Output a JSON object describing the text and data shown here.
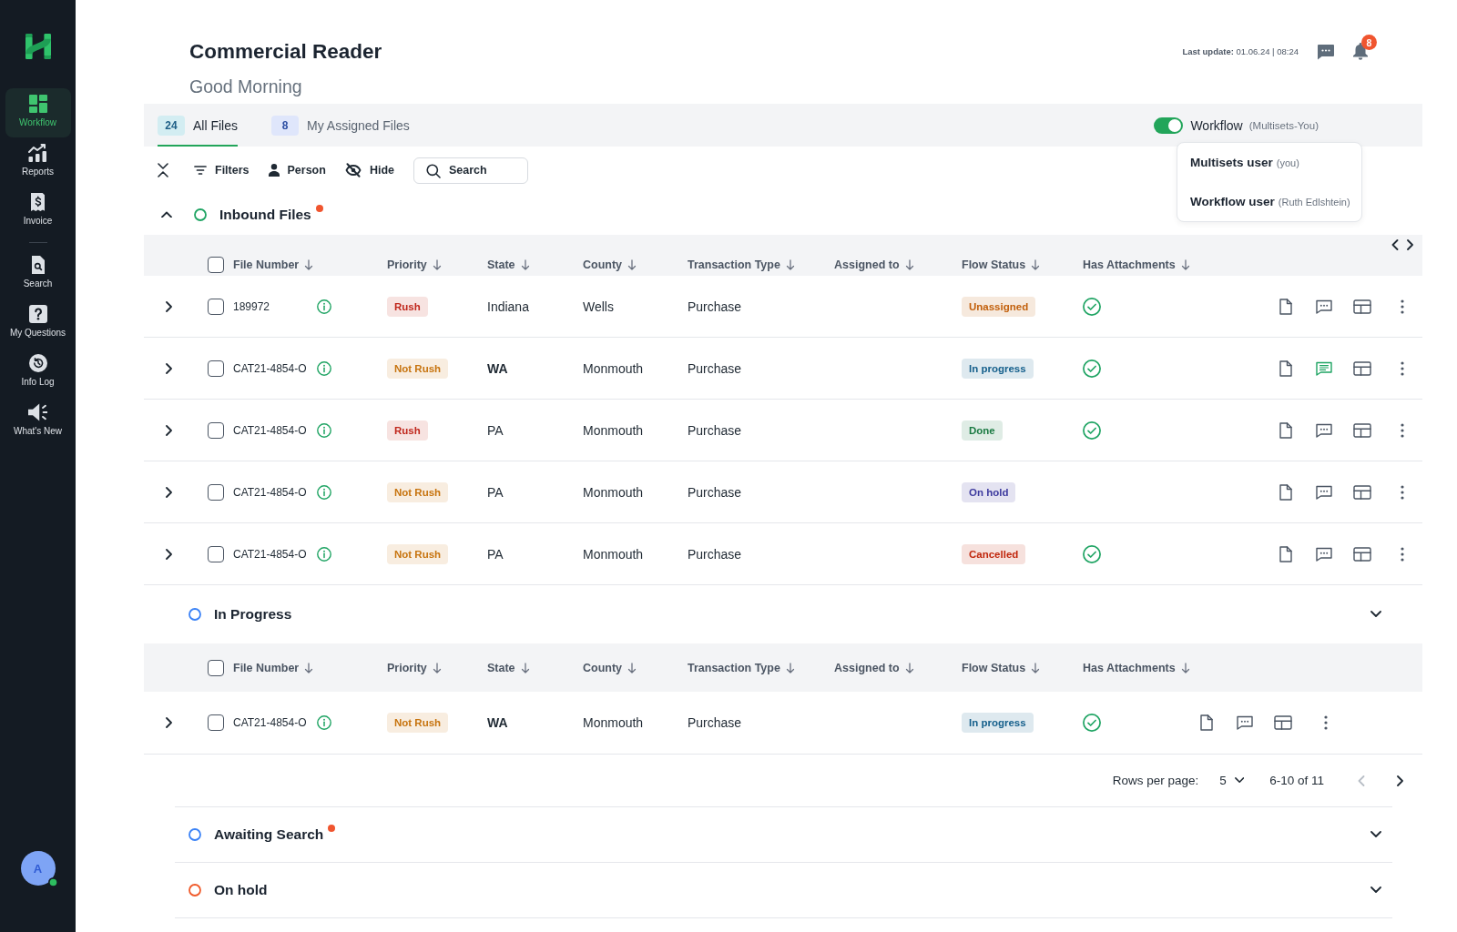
{
  "sidebar": {
    "items": [
      {
        "label": "Workflow",
        "selected": true
      },
      {
        "label": "Reports",
        "selected": false
      },
      {
        "label": "Invoice",
        "selected": false
      }
    ],
    "more_items": [
      {
        "label": "Search",
        "selected": false
      },
      {
        "label": "My Questions",
        "selected": false
      },
      {
        "label": "Info Log",
        "selected": false
      },
      {
        "label": "What's New",
        "selected": false
      }
    ],
    "avatar": {
      "initial": "A",
      "online": true
    }
  },
  "header": {
    "title": "Commercial Reader",
    "greeting": "Good Morning",
    "last_update": "**Last update:** 01.06.24 | 08:24",
    "notification_count": "8"
  },
  "tabs": [
    {
      "count": "24",
      "label": "All Files",
      "selected": true
    },
    {
      "count": "8",
      "label": "My Assigned Files",
      "selected": false
    }
  ],
  "workflow_toggle": {
    "on": true,
    "label": "Workflow",
    "detail": "(Multisets-You)"
  },
  "workflow_menu": {
    "items": [
      {
        "name": "Multisets user",
        "detail": "(you)"
      },
      {
        "name": "Workflow user",
        "detail": "(Ruth Edlshtein)"
      }
    ]
  },
  "toolbar": {
    "buttons": [
      "Filters",
      "Person",
      "Hide"
    ],
    "search": {
      "placeholder": "Search"
    }
  },
  "groups": [
    {
      "kind": "primary",
      "title": "Inbound Files",
      "color": "#1fa463",
      "unread": true,
      "expanded": true,
      "select_all_checked": false,
      "columns": [
        "File Number",
        "Priority",
        "State",
        "County",
        "Transaction Type",
        "Assigned to",
        "Flow Status",
        "Has Attachments"
      ],
      "rows": [
        {
          "expanded": false,
          "checked": false,
          "file_number": "189972",
          "priority": {
            "label": "Rush",
            "color": "#c0271c"
          },
          "state": "Indiana",
          "state_bold": false,
          "county": "Wells",
          "transaction_type": "Purchase",
          "flow_status": {
            "label": "Unassigned",
            "color": "#c2600c"
          },
          "has_attachments": true,
          "comments_active": false
        },
        {
          "expanded": false,
          "checked": false,
          "file_number": "CAT21-4854-O",
          "priority": {
            "label": "Not Rush",
            "color": "#c7740f"
          },
          "state": "WA",
          "state_bold": true,
          "county": "Monmouth",
          "transaction_type": "Purchase",
          "flow_status": {
            "label": "In progress",
            "color": "#16608c"
          },
          "has_attachments": true,
          "comments_active": true
        },
        {
          "expanded": false,
          "checked": false,
          "file_number": "CAT21-4854-O",
          "priority": {
            "label": "Rush",
            "color": "#c0271c"
          },
          "state": "PA",
          "state_bold": false,
          "county": "Monmouth",
          "transaction_type": "Purchase",
          "flow_status": {
            "label": "Done",
            "color": "#1b7a43"
          },
          "has_attachments": true,
          "comments_active": false
        },
        {
          "expanded": false,
          "checked": false,
          "file_number": "CAT21-4854-O",
          "priority": {
            "label": "Not Rush",
            "color": "#c7740f"
          },
          "state": "PA",
          "state_bold": false,
          "county": "Monmouth",
          "transaction_type": "Purchase",
          "flow_status": {
            "label": "On hold",
            "color": "#3d3a9e"
          },
          "has_attachments": false,
          "comments_active": false
        },
        {
          "expanded": false,
          "checked": false,
          "file_number": "CAT21-4854-O",
          "priority": {
            "label": "Not Rush",
            "color": "#c7740f"
          },
          "state": "PA",
          "state_bold": false,
          "county": "Monmouth",
          "transaction_type": "Purchase",
          "flow_status": {
            "label": "Cancelled",
            "color": "#c0260c"
          },
          "has_attachments": true,
          "comments_active": false
        }
      ]
    },
    {
      "kind": "secondary",
      "title": "In Progress",
      "color": "#3b82f6",
      "unread": false,
      "expanded": false,
      "select_all_checked": false,
      "columns": [
        "File Number",
        "Priority",
        "State",
        "County",
        "Transaction Type",
        "Assigned to",
        "Flow Status",
        "Has Attachments"
      ],
      "rows": [
        {
          "expanded": false,
          "checked": false,
          "file_number": "CAT21-4854-O",
          "priority": {
            "label": "Not Rush",
            "color": "#c7740f"
          },
          "state": "WA",
          "state_bold": true,
          "county": "Monmouth",
          "transaction_type": "Purchase",
          "flow_status": {
            "label": "In progress",
            "color": "#16608c"
          },
          "has_attachments": true,
          "comments_active": false
        }
      ],
      "pagination": {
        "label": "Rows per page:",
        "rows_per_page": "5",
        "range": "6-10 of 11",
        "previous_disabled": true,
        "next_disabled": false
      }
    },
    {
      "kind": "secondary",
      "title": "Awaiting Search",
      "color": "#3b82f6",
      "unread": true,
      "expanded": false
    },
    {
      "kind": "secondary",
      "title": "On hold",
      "color": "#f05a2a",
      "unread": false,
      "expanded": false
    }
  ]
}
